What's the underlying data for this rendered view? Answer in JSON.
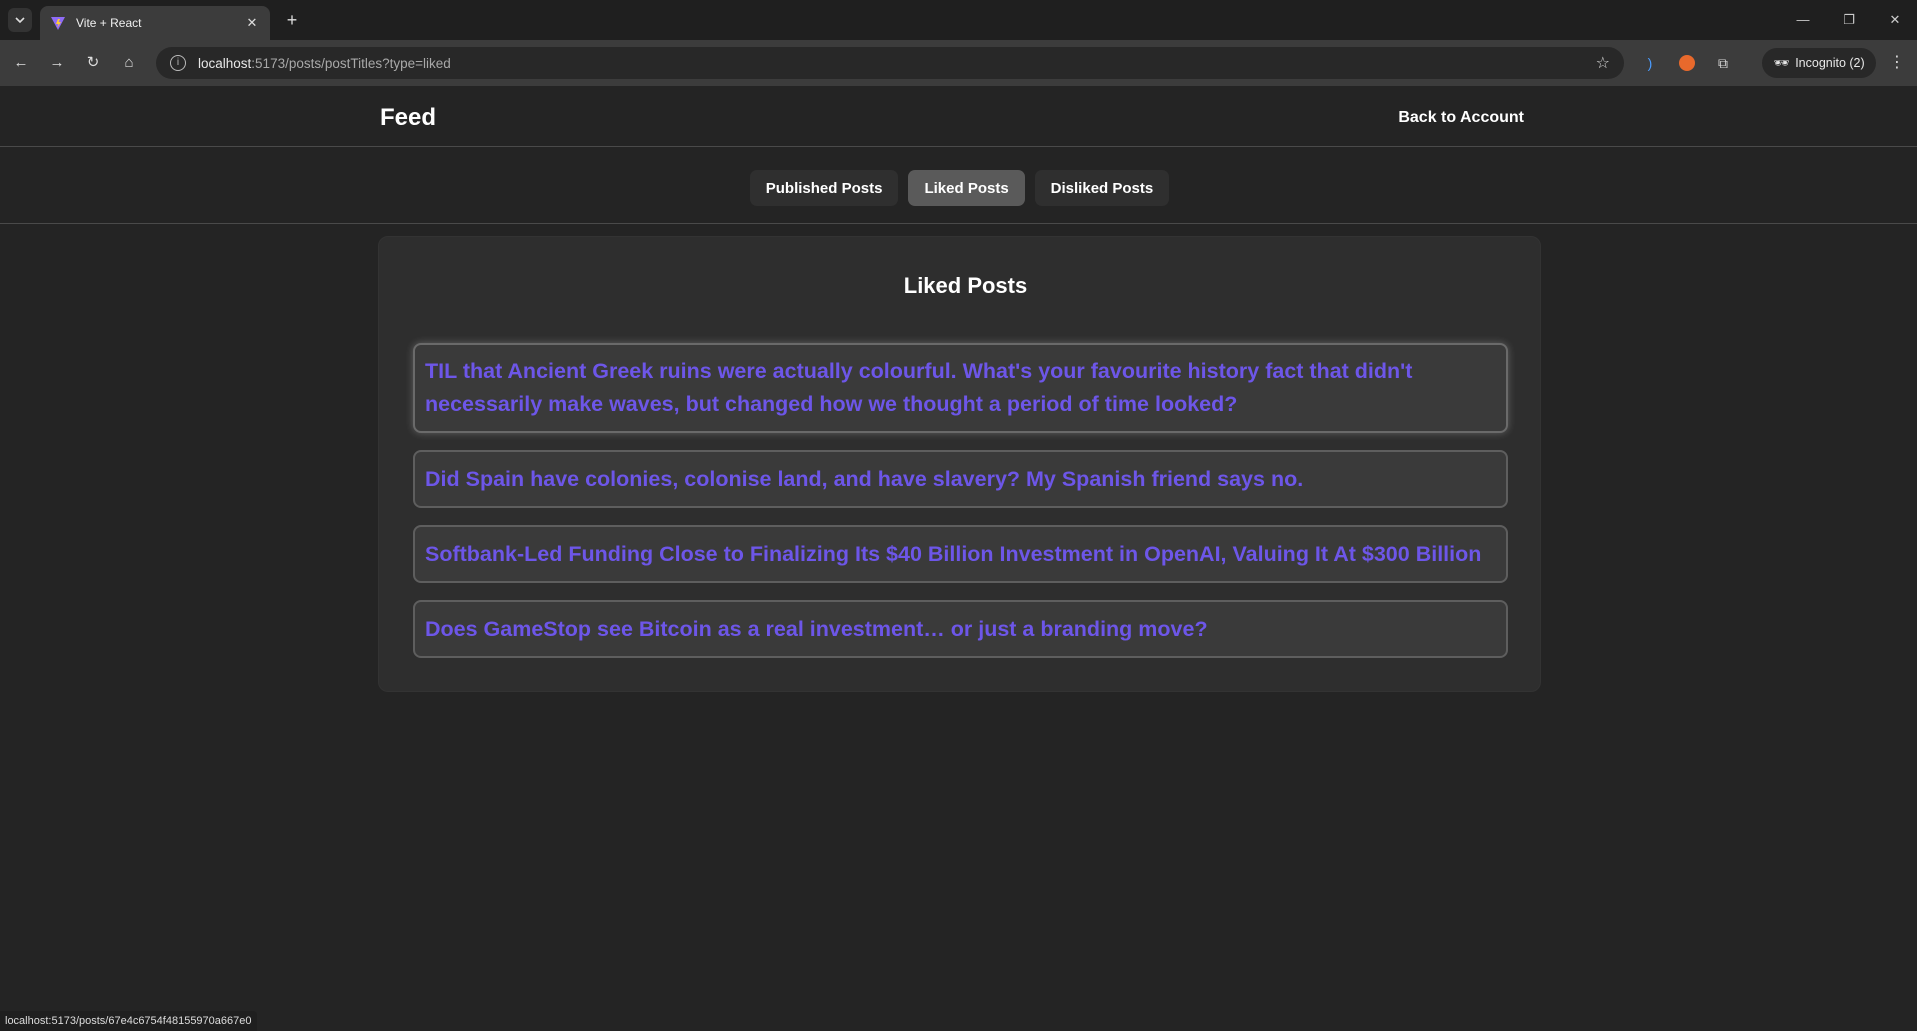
{
  "browser": {
    "tab_title": "Vite + React",
    "url_host": "localhost",
    "url_rest": ":5173/posts/postTitles?type=liked",
    "incognito_label": "Incognito (2)",
    "icons": [
      "tab-search-icon",
      "vite-logo-icon",
      "close-icon",
      "plus-icon",
      "minimize-icon",
      "restore-icon",
      "close-window-icon",
      "back-arrow-icon",
      "forward-arrow-icon",
      "reload-icon",
      "home-icon",
      "info-icon",
      "star-icon",
      "extension-icon",
      "puzzle-icon",
      "incognito-icon",
      "kebab-menu-icon"
    ]
  },
  "header": {
    "brand": "Feed",
    "back_link": "Back to Account"
  },
  "tabs": [
    {
      "label": "Published Posts"
    },
    {
      "label": "Liked Posts",
      "active": true
    },
    {
      "label": "Disliked Posts"
    }
  ],
  "card": {
    "title": "Liked Posts",
    "posts": [
      {
        "line1": "TIL that Ancient Greek ruins were actually colourful. What's your favourite history fact that didn't",
        "line2": "necessarily make waves, but changed how we thought a period of time looked?"
      },
      {
        "title": "Did Spain have colonies, colonise land, and have slavery? My Spanish friend says no."
      },
      {
        "title": "Softbank-Led Funding Close to Finalizing Its $40 Billion Investment in OpenAI, Valuing It At $300 Billion"
      },
      {
        "title": "Does GameStop see Bitcoin as a real investment… or just a branding move?"
      }
    ]
  },
  "statusbar": {
    "text": "localhost:5173/posts/67e4c6754f48155970a667e0"
  },
  "colors": {
    "accent": "#6d56e8",
    "background": "#242424",
    "card": "#2e2e2e"
  }
}
